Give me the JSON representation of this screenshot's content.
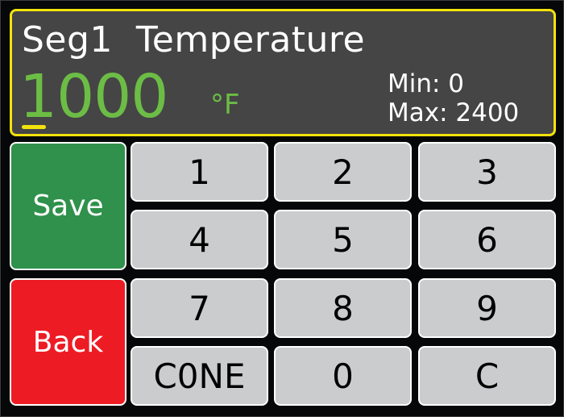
{
  "display": {
    "title": "Seg1  Temperature",
    "value": "1000",
    "unit": "°F",
    "min_label": "Min: 0",
    "max_label": "Max: 2400",
    "colors": {
      "border": "#f2e20c",
      "value": "#6cbd45",
      "panel": "#454545"
    }
  },
  "actions": {
    "save_label": "Save",
    "back_label": "Back",
    "save_color": "#2f914b",
    "back_color": "#ed1c24"
  },
  "keypad": {
    "keys": [
      "1",
      "2",
      "3",
      "4",
      "5",
      "6",
      "7",
      "8",
      "9",
      "C0NE",
      "0",
      "C"
    ]
  }
}
